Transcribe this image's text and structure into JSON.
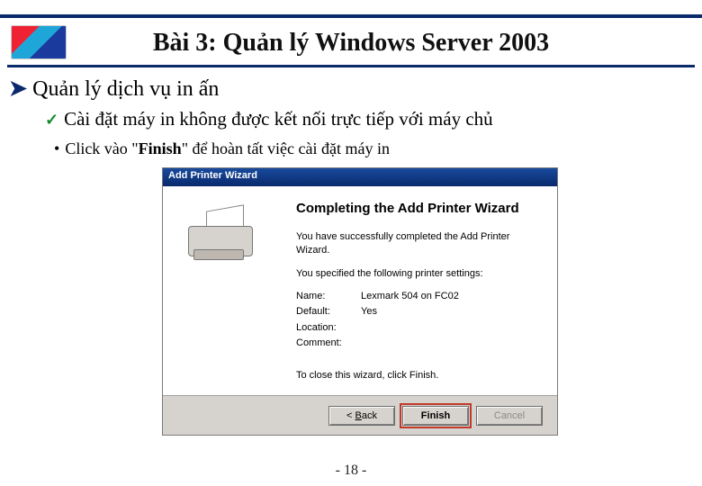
{
  "header": {
    "lesson_title": "Bài 3: Quản lý Windows Server 2003"
  },
  "content": {
    "section": "Quản lý dịch vụ in ấn",
    "subpoint": "Cài đặt máy in không được kết nối trực tiếp với máy chủ",
    "bullet_pre": "Click vào \"",
    "bullet_strong": "Finish",
    "bullet_post": "\" để hoàn tất việc cài đặt máy in"
  },
  "wizard": {
    "titlebar": "Add Printer Wizard",
    "heading": "Completing the Add Printer Wizard",
    "line1": "You have successfully completed the Add Printer Wizard.",
    "line2": "You specified the following printer settings:",
    "name_label": "Name:",
    "name_value": "Lexmark 504 on FC02",
    "default_label": "Default:",
    "default_value": "Yes",
    "location_label": "Location:",
    "location_value": "",
    "comment_label": "Comment:",
    "comment_value": "",
    "close_hint": "To close this wizard, click Finish.",
    "buttons": {
      "back_prefix": "< ",
      "back_u": "B",
      "back_rest": "ack",
      "finish": "Finish",
      "cancel": "Cancel"
    }
  },
  "footer": {
    "page": "- 18 -"
  }
}
